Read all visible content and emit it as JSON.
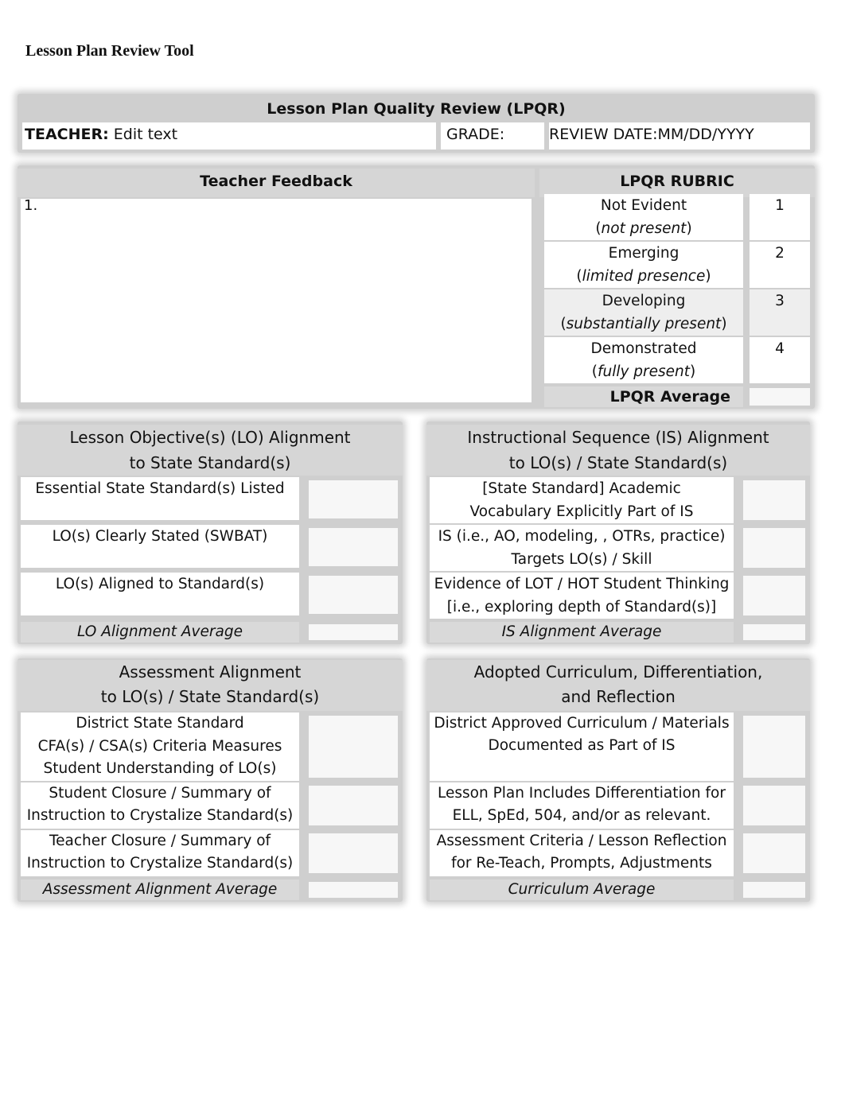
{
  "document": {
    "title": "Lesson Plan Review Tool"
  },
  "header": {
    "title": "Lesson Plan Quality Review (LPQR)",
    "teacher_label": "TEACHER:",
    "teacher_value": "Edit text",
    "grade_label": "GRADE:",
    "grade_value": "",
    "review_date_label": "REVIEW DATE:",
    "review_date_value": "MM/DD/YYYY"
  },
  "feedback": {
    "title": "Teacher Feedback",
    "items": [
      "1."
    ]
  },
  "rubric": {
    "title": "LPQR RUBRIC",
    "levels": [
      {
        "label": "Not Evident",
        "description": "not present",
        "score": "1"
      },
      {
        "label": "Emerging",
        "description": "limited presence",
        "score": "2"
      },
      {
        "label": "Developing",
        "description": "substantially present",
        "score": "3"
      },
      {
        "label": "Demonstrated",
        "description": "fully present",
        "score": "4"
      }
    ],
    "average_label": "LPQR Average",
    "average_value": ""
  },
  "sections": {
    "lo": {
      "title_line1": "Lesson Objective(s) (LO) Alignment",
      "title_line2": "to State Standard(s)",
      "criteria": [
        {
          "line1": "Essential State Standard(s) Listed",
          "line2": ""
        },
        {
          "line1": "LO(s) Clearly Stated (SWBAT)",
          "line2": ""
        },
        {
          "line1": "LO(s) Aligned to Standard(s)",
          "line2": ""
        }
      ],
      "average_label": "LO Alignment Average"
    },
    "is": {
      "title_line1": "Instructional Sequence (IS) Alignment",
      "title_line2": "to LO(s) / State Standard(s)",
      "criteria": [
        {
          "line1": "[State Standard] Academic",
          "line2": "Vocabulary Explicitly Part of IS"
        },
        {
          "line1": "IS (i.e., AO, modeling, , OTRs, practice)",
          "line2": "Targets LO(s) / Skill"
        },
        {
          "line1": "Evidence of LOT / HOT Student Thinking",
          "line2": "[i.e., exploring depth of Standard(s)]"
        }
      ],
      "average_label": "IS Alignment Average"
    },
    "assessment": {
      "title_line1": "Assessment Alignment",
      "title_line2": "to LO(s) / State Standard(s)",
      "criteria": [
        {
          "line1": "District State Standard",
          "line2": "CFA(s) / CSA(s) Criteria Measures",
          "line3": "Student Understanding of LO(s)"
        },
        {
          "line1": "Student Closure / Summary of",
          "line2": "Instruction to Crystalize Standard(s)",
          "line3": ""
        },
        {
          "line1": "Teacher Closure / Summary of",
          "line2": "Instruction to Crystalize Standard(s)",
          "line3": ""
        }
      ],
      "average_label": "Assessment Alignment Average"
    },
    "curriculum": {
      "title_line1": "Adopted Curriculum, Differentiation,",
      "title_line2": "and Reflection",
      "criteria": [
        {
          "line1": "District Approved Curriculum / Materials",
          "line2": "Documented as Part of IS"
        },
        {
          "line1": "Lesson Plan Includes Differentiation for",
          "line2": "ELL, SpEd, 504, and/or as relevant."
        },
        {
          "line1": "Assessment Criteria / Lesson Reflection",
          "line2": "for Re-Teach, Prompts, Adjustments"
        }
      ],
      "average_label": "Curriculum Average"
    }
  }
}
